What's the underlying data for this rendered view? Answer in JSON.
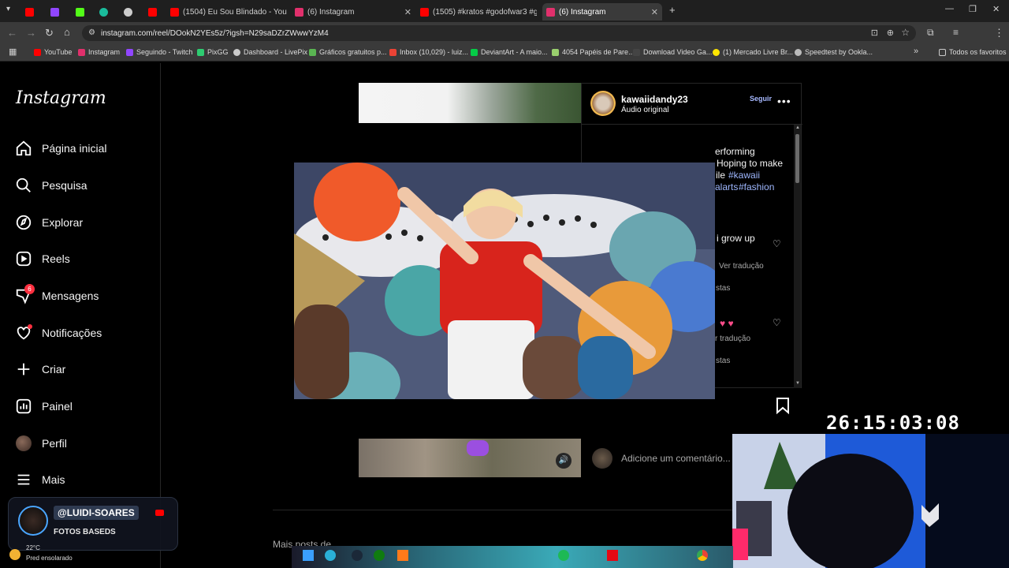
{
  "browser": {
    "tabs": [
      {
        "title": "",
        "color": "#ff0000"
      },
      {
        "title": "",
        "color": "#9146ff"
      },
      {
        "title": "",
        "color": "#53fc18"
      },
      {
        "title": "",
        "color": "#1abc9c"
      },
      {
        "title": "",
        "color": "#cccccc"
      },
      {
        "title": "",
        "color": "#ff0000"
      },
      {
        "title": "(1504) Eu Sou Blindado - YouTu",
        "color": "#ff0000"
      },
      {
        "title": "(6) Instagram",
        "color": "#e1306c"
      },
      {
        "title": "(1505) #kratos #godofwar3 #g",
        "color": "#ff0000"
      },
      {
        "title": "(6) Instagram",
        "color": "#e1306c"
      }
    ],
    "url": "instagram.com/reel/DOokN2YEs5z/?igsh=N29saDZrZWwwYzM4",
    "bookmarks": [
      {
        "label": "YouTube",
        "color": "#ff0000"
      },
      {
        "label": "Instagram",
        "color": "#e1306c"
      },
      {
        "label": "Seguindo - Twitch",
        "color": "#9146ff"
      },
      {
        "label": "PixGG",
        "color": "#2ecc71"
      },
      {
        "label": "Dashboard - LivePix",
        "color": "#cccccc"
      },
      {
        "label": "Gráficos gratuitos p...",
        "color": "#5ab552"
      },
      {
        "label": "Inbox (10,029) - luiz...",
        "color": "#ea4335"
      },
      {
        "label": "DeviantArt - A maio...",
        "color": "#05cc47"
      },
      {
        "label": "4054 Papéis de Pare...",
        "color": "#9ad06e"
      },
      {
        "label": "Download Video Ga...",
        "color": "#444444"
      },
      {
        "label": "(1) Mercado Livre Br...",
        "color": "#ffe600"
      },
      {
        "label": "Speedtest by Ookla...",
        "color": "#bbbbbb"
      }
    ],
    "favorites_label": "Todos os favoritos"
  },
  "instagram": {
    "logo": "Instagram",
    "nav": [
      {
        "label": "Página inicial",
        "icon": "home-icon"
      },
      {
        "label": "Pesquisa",
        "icon": "search-icon"
      },
      {
        "label": "Explorar",
        "icon": "compass-icon"
      },
      {
        "label": "Reels",
        "icon": "reels-icon"
      },
      {
        "label": "Mensagens",
        "icon": "messenger-icon",
        "badge": "6"
      },
      {
        "label": "Notificações",
        "icon": "heart-icon"
      },
      {
        "label": "Criar",
        "icon": "plus-icon"
      },
      {
        "label": "Painel",
        "icon": "dashboard-icon"
      },
      {
        "label": "Perfil",
        "icon": "avatar"
      },
      {
        "label": "Mais",
        "icon": "menu-icon"
      }
    ],
    "post": {
      "username": "kawaiidandy23",
      "audio": "Áudio original",
      "follow": "Seguir",
      "caption_lines": [
        "erforming",
        "Hoping to make",
        "ile "
      ],
      "tags1": "#kawaii",
      "tags2_prefix": "alarts ",
      "tags2": "#fashion",
      "comment1": "i grow up",
      "see_translation": "Ver tradução",
      "replies": "stas",
      "see_translation2": "r tradução",
      "replies2": "stas",
      "comment_placeholder": "Adicione um comentário...",
      "more_text": "Mais posts de"
    }
  },
  "stream": {
    "timer": "26:15:03:08",
    "handle": "@LUIDI-SOARES",
    "subtitle": "FOTOS BASEDS"
  },
  "weather": {
    "temp": "22°C",
    "desc": "Pred ensolarado"
  },
  "colors": {
    "accent_link": "#9fb8ff",
    "follow": "#a7b9ff",
    "badge": "#ff3040"
  }
}
